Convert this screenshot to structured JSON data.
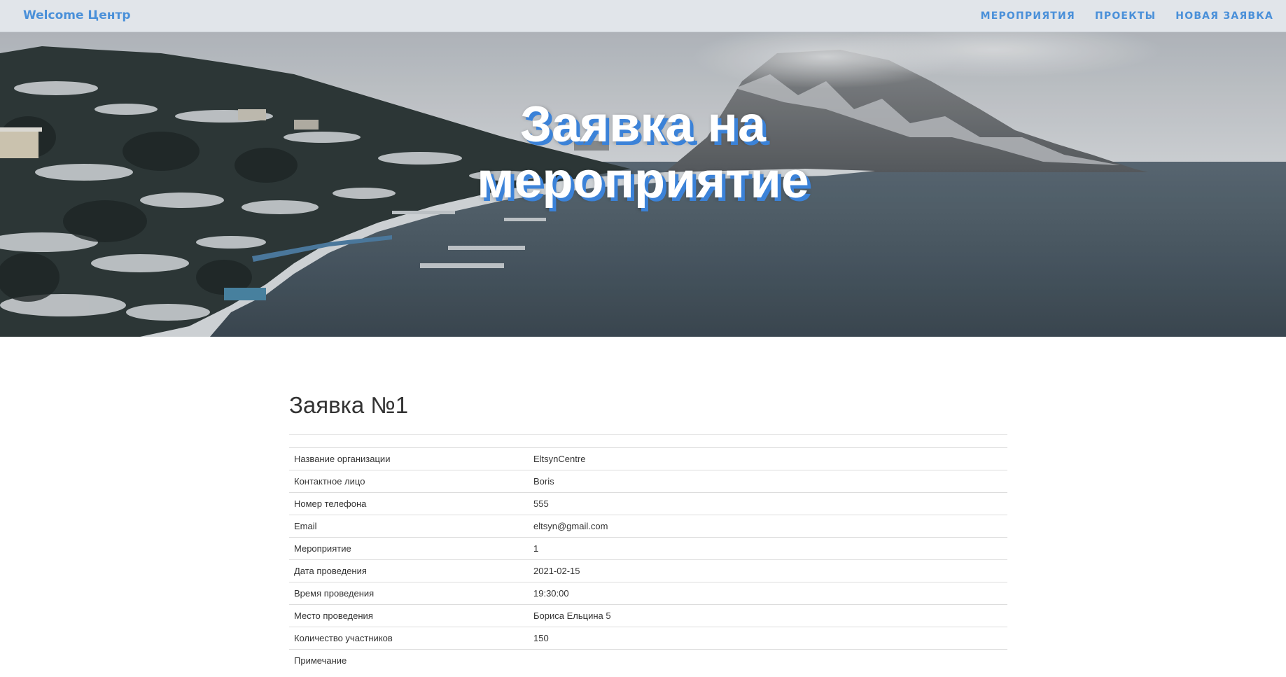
{
  "navbar": {
    "brand": "Welcome Центр",
    "links": [
      "МЕРОПРИЯТИЯ",
      "ПРОЕКТЫ",
      "НОВАЯ ЗАЯВКА"
    ]
  },
  "hero": {
    "title_line1": "Заявка на",
    "title_line2": "мероприятие"
  },
  "request": {
    "title": "Заявка №1",
    "rows": [
      {
        "label": "Название организации",
        "value": "EltsynCentre"
      },
      {
        "label": "Контактное лицо",
        "value": "Boris"
      },
      {
        "label": "Номер телефона",
        "value": "555"
      },
      {
        "label": "Email",
        "value": "eltsyn@gmail.com"
      },
      {
        "label": "Мероприятие",
        "value": "1"
      },
      {
        "label": "Дата проведения",
        "value": "2021-02-15"
      },
      {
        "label": "Время проведения",
        "value": "19:30:00"
      },
      {
        "label": "Место проведения",
        "value": "Бориса Ельцина 5"
      },
      {
        "label": "Количество участников",
        "value": "150"
      },
      {
        "label": "Примечание",
        "value": ""
      }
    ]
  },
  "colors": {
    "accent": "#4a90d9",
    "title_shadow": "#3b82d8",
    "navbar_bg": "#e0e4e9"
  }
}
